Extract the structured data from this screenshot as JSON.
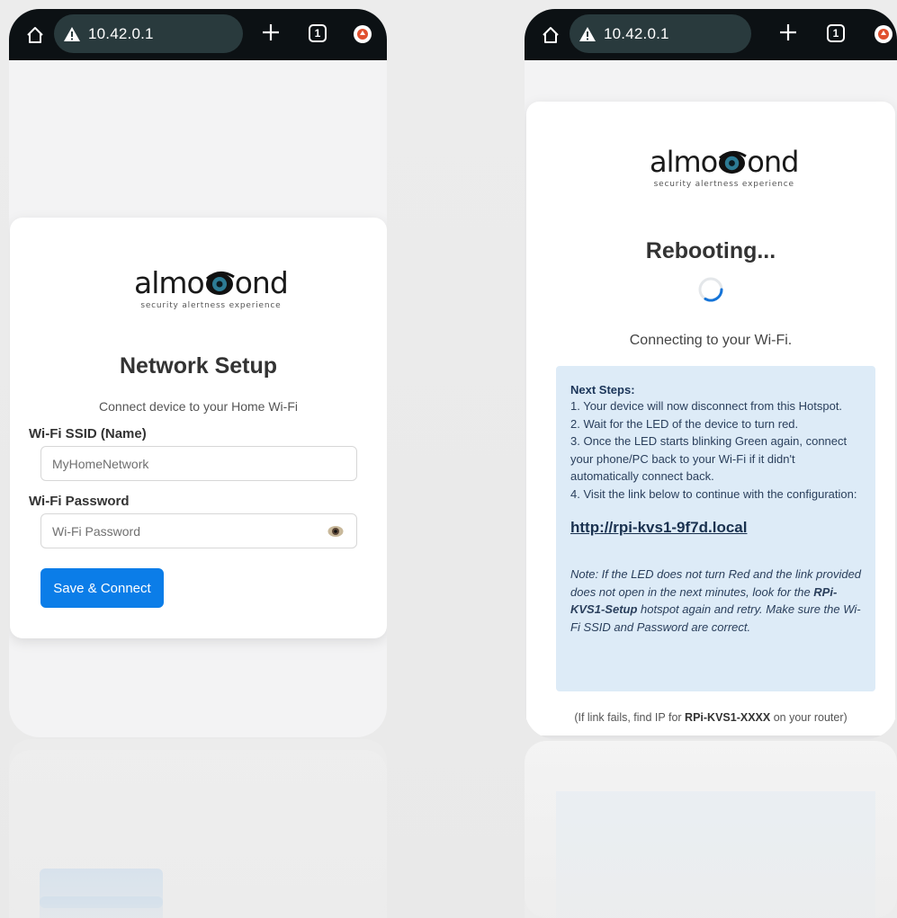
{
  "browser": {
    "url": "10.42.0.1",
    "tab_count": "1"
  },
  "logo": {
    "wordmark": "almo●ond",
    "tagline": "security alertness experience"
  },
  "network_setup": {
    "title": "Network Setup",
    "subtitle": "Connect device to your Home Wi-Fi",
    "ssid_label": "Wi-Fi SSID (Name)",
    "ssid_value": "MyHomeNetwork",
    "password_label": "Wi-Fi Password",
    "password_placeholder": "Wi-Fi Password",
    "submit_label": "Save & Connect"
  },
  "rebooting": {
    "title": "Rebooting...",
    "status": "Connecting to your Wi-Fi.",
    "steps_heading": "Next Steps:",
    "steps": [
      "1. Your device will now disconnect from this Hotspot.",
      "2. Wait for the LED of the device to turn red.",
      "3. Once the LED starts blinking Green again, connect your phone/PC back to your Wi-Fi if it didn't automatically connect back.",
      "4. Visit the link below to continue with the configuration:"
    ],
    "link": "http://rpi-kvs1-9f7d.local",
    "note_prefix": "Note: If the LED does not turn Red and the link provided does not open in the next minutes, look for the ",
    "note_hotspot": "RPi-KVS1-Setup",
    "note_suffix": " hotspot again and retry. Make sure the Wi-Fi SSID and Password are correct.",
    "fallback_prefix": "(If link fails, find IP for ",
    "fallback_host": "RPi-KVS1-XXXX",
    "fallback_suffix": " on your router)"
  },
  "colors": {
    "browser_bar": "#0c1114",
    "url_pill": "#293a3d",
    "primary_button": "#0b7de8",
    "steps_box": "#ddebf7",
    "update_badge": "#e0502f"
  },
  "icons": [
    "home-icon",
    "warning-icon",
    "plus-icon",
    "tabs-icon",
    "update-icon",
    "eye-icon",
    "spinner-icon"
  ]
}
